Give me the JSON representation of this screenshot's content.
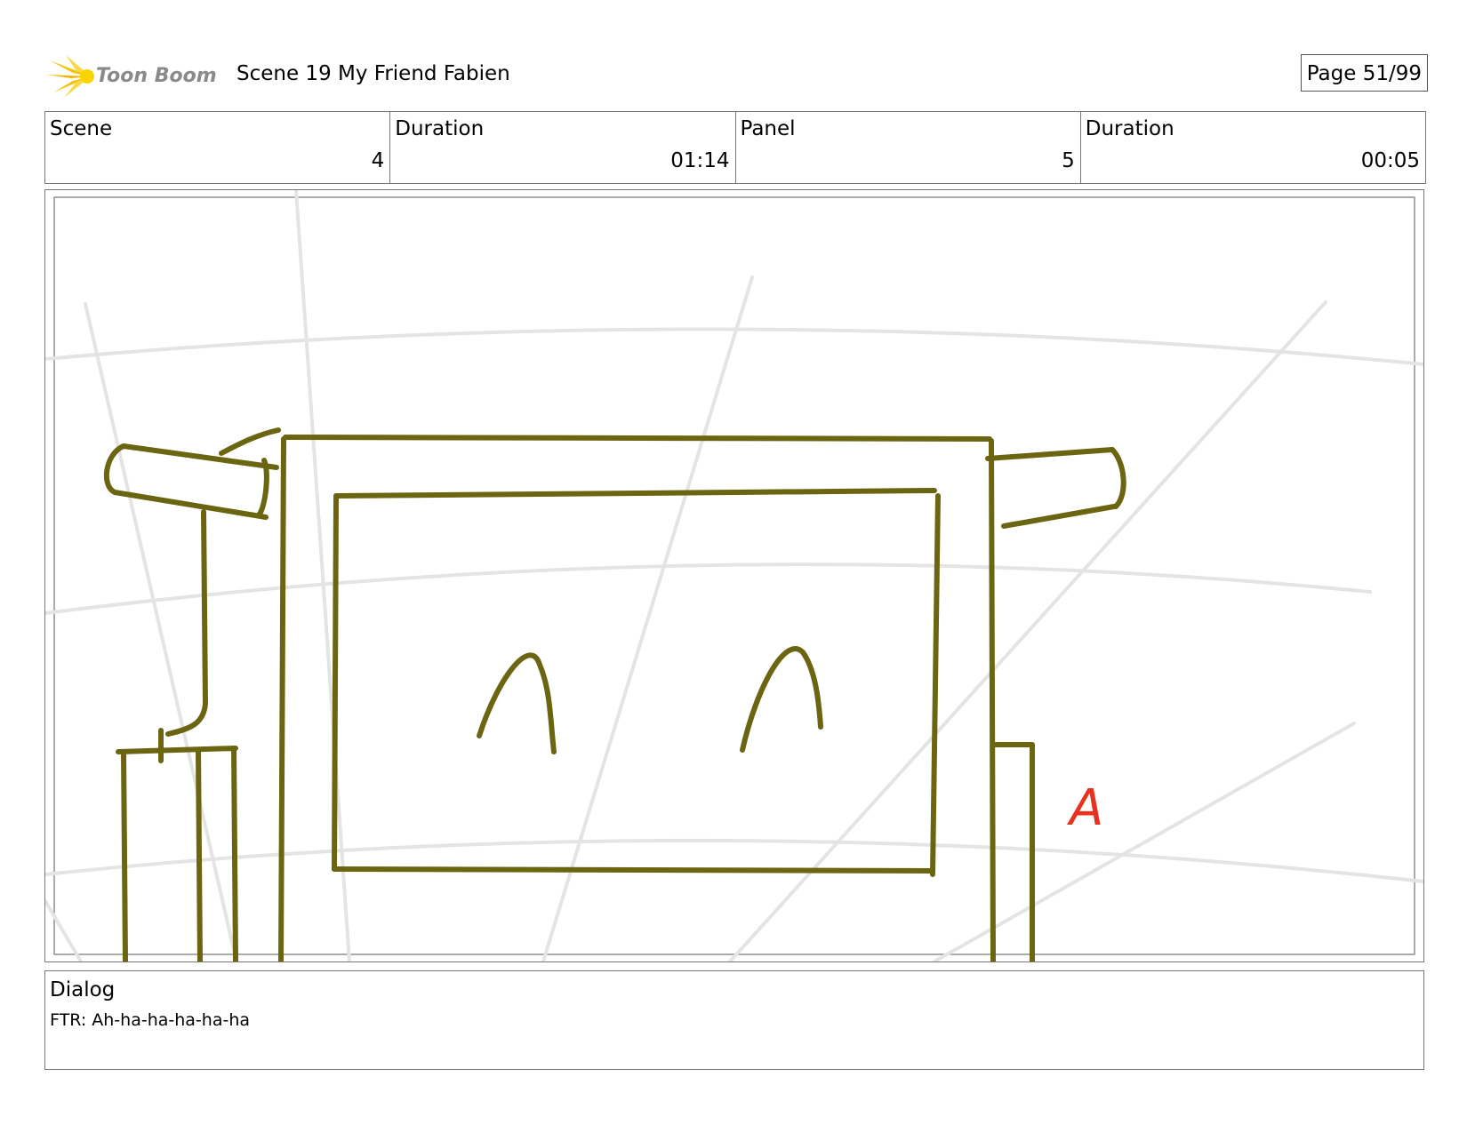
{
  "header": {
    "logo_text": "Toon Boom",
    "scene_title": "Scene 19 My Friend Fabien",
    "page_label": "Page 51/99"
  },
  "info": [
    {
      "label": "Scene",
      "value": "4"
    },
    {
      "label": "Duration",
      "value": "01:14"
    },
    {
      "label": "Panel",
      "value": "5"
    },
    {
      "label": "Duration",
      "value": "00:05"
    }
  ],
  "panel": {
    "annotation_letter": "A",
    "sketch_color": "#6b6410",
    "annotation_color": "#e8321e",
    "guide_color": "#e4e4e4"
  },
  "dialog": {
    "label": "Dialog",
    "text": "FTR: Ah-ha-ha-ha-ha-ha"
  }
}
